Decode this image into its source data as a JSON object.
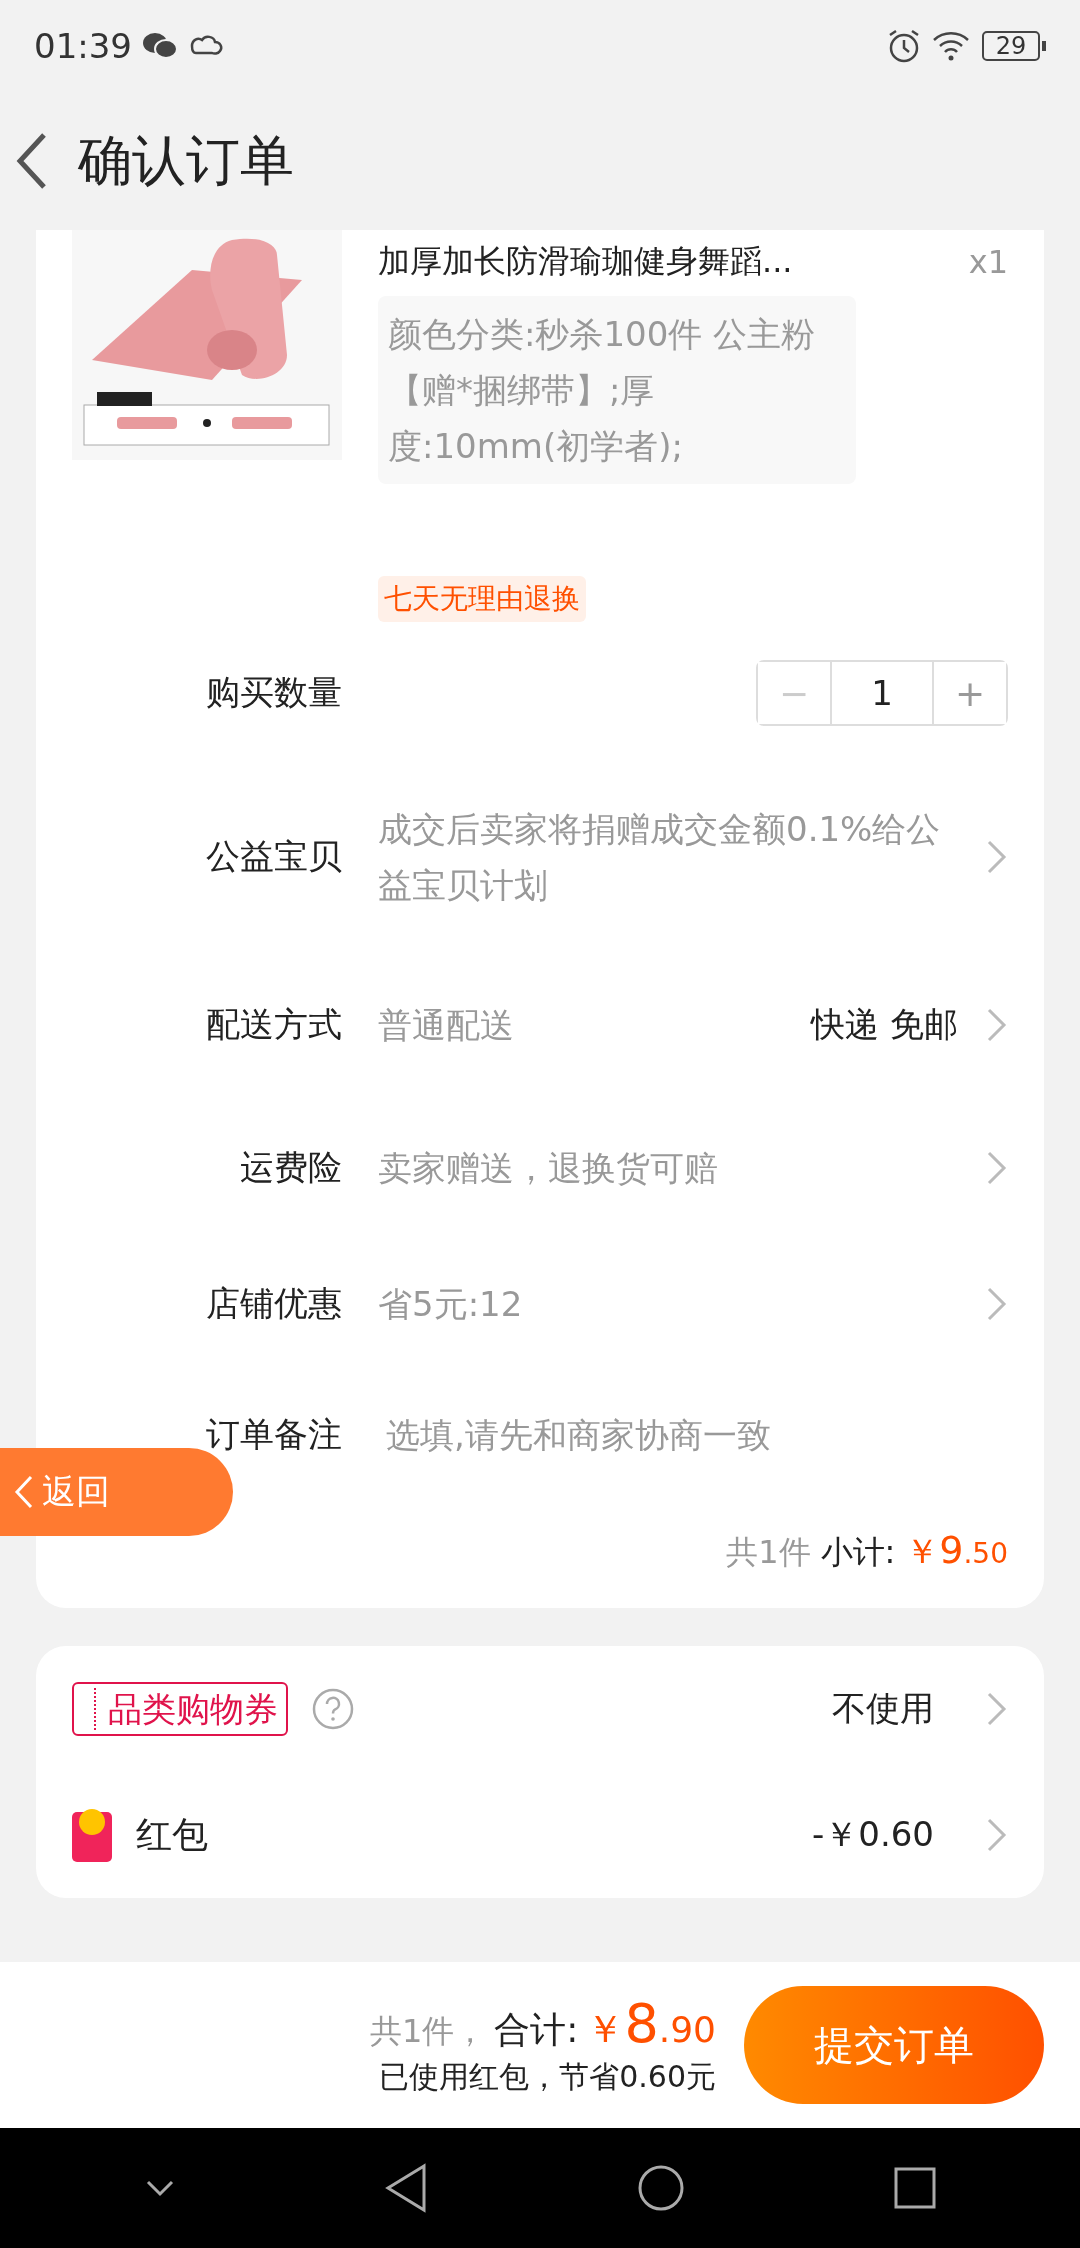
{
  "status_bar": {
    "time": "01:39",
    "battery": "29"
  },
  "header": {
    "title": "确认订单"
  },
  "product": {
    "title": "加厚加长防滑瑜珈健身舞蹈...",
    "quantity": "x1",
    "spec": "颜色分类:秒杀100件 公主粉【赠*捆绑带】;厚度:10mm(初学者);",
    "badge": "七天无理由退换"
  },
  "rows": [
    {
      "kind": "stepper",
      "label": "购买数量",
      "minus": "−",
      "value": "1",
      "plus": "+"
    },
    {
      "kind": "info",
      "label": "公益宝贝",
      "value": "成交后卖家将捐赠成交金额0.1%给公益宝贝计划"
    },
    {
      "kind": "option",
      "label": "配送方式",
      "value": "普通配送",
      "option": "快递 免邮"
    },
    {
      "kind": "info",
      "label": "运费险",
      "value": "卖家赠送，退换货可赔"
    },
    {
      "kind": "info",
      "label": "店铺优惠",
      "value": "省5元:12"
    },
    {
      "kind": "note",
      "label": "订单备注",
      "placeholder": "选填,请先和商家协商一致"
    }
  ],
  "subtotal": {
    "count": "共1件",
    "label": "小计:",
    "currency": "￥",
    "integer": "9",
    "decimal": ".50"
  },
  "float_button": {
    "label": "返回"
  },
  "benefits": [
    {
      "kind": "coupon",
      "label": "品类购物券",
      "value": "不使用"
    },
    {
      "kind": "redpacket",
      "label": "红包",
      "value": "-￥0.60"
    }
  ],
  "footer": {
    "count": "共1件，",
    "total_label": "合计:",
    "currency": "￥",
    "integer": "8",
    "decimal": ".90",
    "saving": "已使用红包，节省0.60元",
    "submit": "提交订单"
  }
}
